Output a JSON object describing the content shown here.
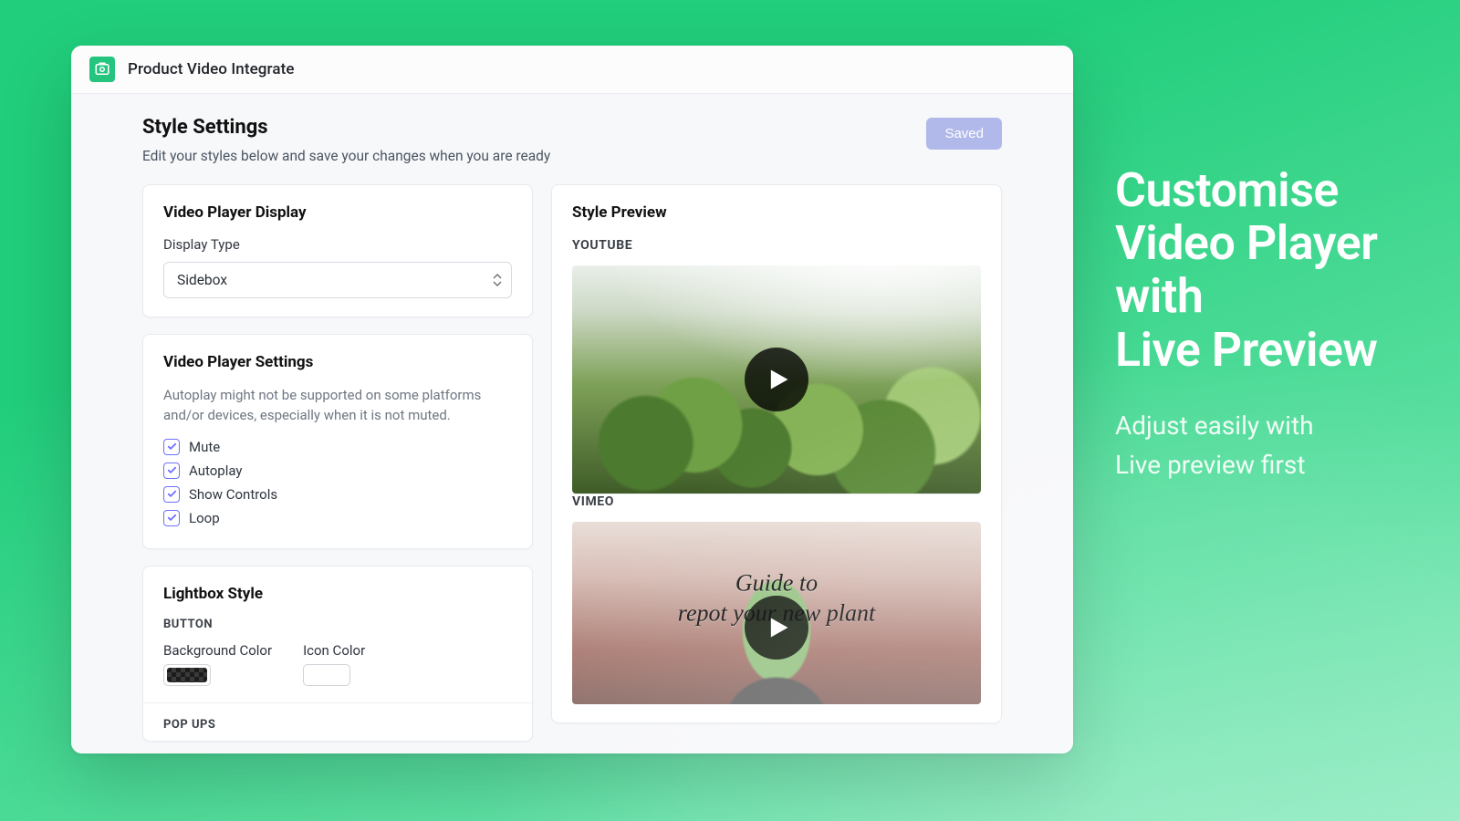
{
  "app": {
    "title": "Product Video Integrate"
  },
  "page": {
    "title": "Style Settings",
    "subtitle": "Edit your styles below and save your changes when you are ready",
    "saved_label": "Saved"
  },
  "display_card": {
    "title": "Video Player Display",
    "field_label": "Display Type",
    "selected": "Sidebox"
  },
  "settings_card": {
    "title": "Video Player Settings",
    "note": "Autoplay might not be supported on some platforms and/or devices, especially when it is not muted.",
    "opts": {
      "mute": "Mute",
      "autoplay": "Autoplay",
      "show_controls": "Show Controls",
      "loop": "Loop"
    }
  },
  "lightbox_card": {
    "title": "Lightbox Style",
    "button_heading": "BUTTON",
    "bg_label": "Background Color",
    "icon_label": "Icon Color",
    "popups_heading": "POP UPS",
    "colors": {
      "bg": "#222222",
      "icon": "#ffffff"
    }
  },
  "preview_card": {
    "title": "Style Preview",
    "youtube_label": "YOUTUBE",
    "vimeo_label": "VIMEO",
    "vimeo_caption_l1": "Guide to",
    "vimeo_caption_l2": "repot your new plant"
  },
  "promo": {
    "headline_l1": "Customise",
    "headline_l2": "Video Player",
    "headline_l3": "with",
    "headline_l4": "Live Preview",
    "sub_l1": "Adjust easily with",
    "sub_l2": "Live preview first"
  }
}
